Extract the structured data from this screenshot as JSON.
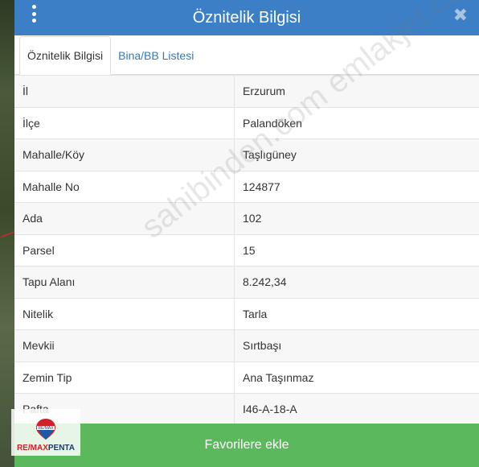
{
  "header": {
    "title": "Öznitelik Bilgisi",
    "close_label": "✖"
  },
  "tabs": [
    {
      "label": "Öznitelik Bilgisi",
      "active": true
    },
    {
      "label": "Bina/BB Listesi",
      "active": false
    }
  ],
  "rows": [
    {
      "key": "İl",
      "value": "Erzurum"
    },
    {
      "key": "İlçe",
      "value": "Palandöken"
    },
    {
      "key": "Mahalle/Köy",
      "value": "Taşlıgüney"
    },
    {
      "key": "Mahalle No",
      "value": "124877"
    },
    {
      "key": "Ada",
      "value": "102"
    },
    {
      "key": "Parsel",
      "value": "15"
    },
    {
      "key": "Tapu Alanı",
      "value": "8.242,34"
    },
    {
      "key": "Nitelik",
      "value": "Tarla"
    },
    {
      "key": "Mevkii",
      "value": "Sırtbaşı"
    },
    {
      "key": "Zemin Tip",
      "value": "Ana Taşınmaz"
    },
    {
      "key": "Pafta",
      "value": "I46-A-18-A"
    }
  ],
  "favorite_button": {
    "label": "Favorilere ekle"
  },
  "watermark": "sahibinden.com emlakjet.com",
  "logo": {
    "part1": "RE",
    "slash": "/",
    "part2": "MAX",
    "part3": "PENTA",
    "balloon_text": "RE/MAX"
  },
  "colors": {
    "header": "#3c7fc6",
    "button": "#5cb85c",
    "link": "#337ab7"
  }
}
